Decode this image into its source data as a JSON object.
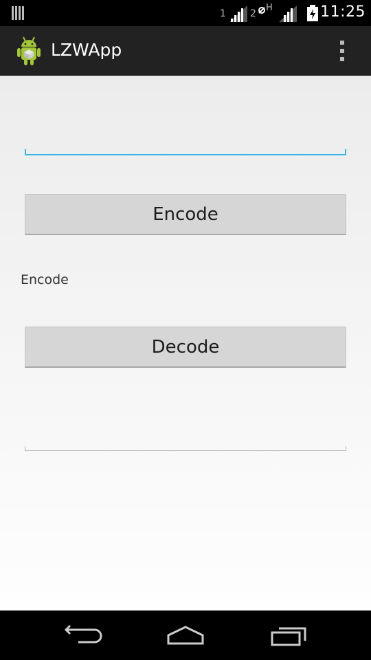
{
  "status_bar": {
    "time": "11:25",
    "sim1_label": "1",
    "sim2_label": "2",
    "network_type": "H",
    "icons": [
      "notification-icon",
      "signal-sim1-icon",
      "data-activity-icon",
      "signal-sim2-icon",
      "battery-charging-icon"
    ]
  },
  "action_bar": {
    "title": "LZWApp",
    "icon": "android-app-icon",
    "overflow_icon": "overflow-menu-icon",
    "background": "#222222"
  },
  "main": {
    "input_value": "",
    "encode_button_label": "Encode",
    "result_label": "Encode",
    "decode_button_label": "Decode",
    "output_value": "",
    "focus_color": "#33b5e5"
  },
  "nav_bar": {
    "icons": [
      "back-icon",
      "home-icon",
      "recent-apps-icon"
    ]
  }
}
